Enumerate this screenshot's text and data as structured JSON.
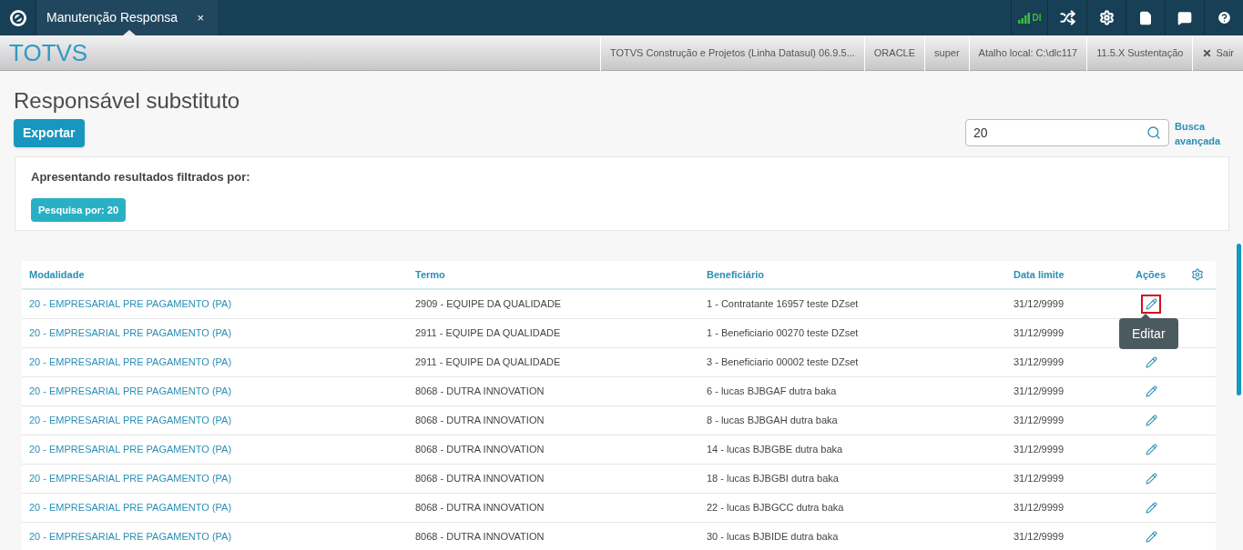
{
  "topbar": {
    "tab": {
      "title": "Manutenção Responsa",
      "close": "×",
      "selected": true
    },
    "status": "DI"
  },
  "infobar": {
    "brand": "TOTVS",
    "items": [
      "TOTVS Construção e Projetos (Linha Datasul) 06.9.5...",
      "ORACLE",
      "super",
      "Atalho local: C:\\dlc117",
      "11.5.X Sustentação"
    ],
    "logout": "Sair"
  },
  "page": {
    "title": "Responsável substituto",
    "export_button": "Exportar",
    "search": {
      "value": "20"
    },
    "advanced_search": "Busca avançada"
  },
  "filters": {
    "heading": "Apresentando resultados filtrados por:",
    "tags": [
      "Pesquisa por: 20"
    ]
  },
  "table": {
    "columns": [
      "Modalidade",
      "Termo",
      "Beneficiário",
      "Data limite",
      "Ações"
    ],
    "rows": [
      {
        "modalidade": "20 - EMPRESARIAL PRE PAGAMENTO (PA)",
        "termo": "2909 - EQUIPE DA QUALIDADE",
        "beneficiario": "1 - Contratante 16957 teste DZset",
        "data": "31/12/9999",
        "focused": true,
        "tooltip": "Editar"
      },
      {
        "modalidade": "20 - EMPRESARIAL PRE PAGAMENTO (PA)",
        "termo": "2911 - EQUIPE DA QUALIDADE",
        "beneficiario": "1 - Beneficiario 00270 teste DZset",
        "data": "31/12/9999",
        "focused": false
      },
      {
        "modalidade": "20 - EMPRESARIAL PRE PAGAMENTO (PA)",
        "termo": "2911 - EQUIPE DA QUALIDADE",
        "beneficiario": "3 - Beneficiario 00002 teste DZset",
        "data": "31/12/9999",
        "focused": false
      },
      {
        "modalidade": "20 - EMPRESARIAL PRE PAGAMENTO (PA)",
        "termo": "8068 - DUTRA INNOVATION",
        "beneficiario": "6 - lucas BJBGAF dutra baka",
        "data": "31/12/9999",
        "focused": false
      },
      {
        "modalidade": "20 - EMPRESARIAL PRE PAGAMENTO (PA)",
        "termo": "8068 - DUTRA INNOVATION",
        "beneficiario": "8 - lucas BJBGAH dutra baka",
        "data": "31/12/9999",
        "focused": false
      },
      {
        "modalidade": "20 - EMPRESARIAL PRE PAGAMENTO (PA)",
        "termo": "8068 - DUTRA INNOVATION",
        "beneficiario": "14 - lucas BJBGBE dutra baka",
        "data": "31/12/9999",
        "focused": false
      },
      {
        "modalidade": "20 - EMPRESARIAL PRE PAGAMENTO (PA)",
        "termo": "8068 - DUTRA INNOVATION",
        "beneficiario": "18 - lucas BJBGBI dutra baka",
        "data": "31/12/9999",
        "focused": false
      },
      {
        "modalidade": "20 - EMPRESARIAL PRE PAGAMENTO (PA)",
        "termo": "8068 - DUTRA INNOVATION",
        "beneficiario": "22 - lucas BJBGCC dutra baka",
        "data": "31/12/9999",
        "focused": false
      },
      {
        "modalidade": "20 - EMPRESARIAL PRE PAGAMENTO (PA)",
        "termo": "8068 - DUTRA INNOVATION",
        "beneficiario": "30 - lucas BJBIDE dutra baka",
        "data": "31/12/9999",
        "focused": false
      }
    ]
  }
}
